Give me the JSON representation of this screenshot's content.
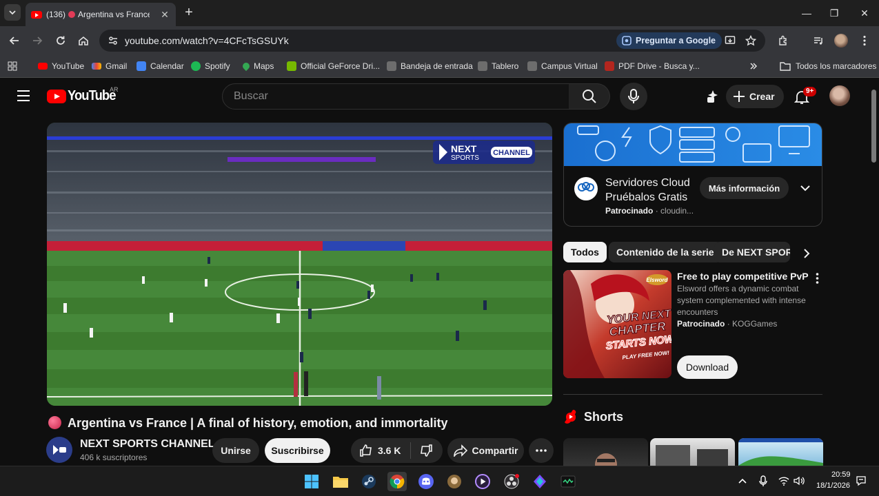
{
  "browser": {
    "tab": {
      "title": "(136)",
      "title_rest": "Argentina vs France | A"
    },
    "url": "youtube.com/watch?v=4CFcTsGSUYk",
    "ask_google": "Preguntar a Google",
    "bookmarks": [
      {
        "label": "YouTube",
        "color": "#ff0000"
      },
      {
        "label": "Gmail",
        "color": "#ea4335"
      },
      {
        "label": "Calendar",
        "color": "#4285f4"
      },
      {
        "label": "Spotify",
        "color": "#1db954"
      },
      {
        "label": "Maps",
        "color": "#34a853"
      },
      {
        "label": "Official GeForce Dri...",
        "color": "#76b900"
      },
      {
        "label": "Bandeja de entrada",
        "color": "#5f6368"
      },
      {
        "label": "Tablero",
        "color": "#5f6368"
      },
      {
        "label": "Campus Virtual",
        "color": "#5f6368"
      },
      {
        "label": "PDF Drive - Busca y...",
        "color": "#b3261e"
      }
    ],
    "all_bookmarks": "Todos los marcadores"
  },
  "yt": {
    "logo": "YouTube",
    "country": "AR",
    "search_placeholder": "Buscar",
    "create": "Crear",
    "notifications": "9+",
    "video": {
      "overlay_brand_1": "NEXT",
      "overlay_brand_2": "SPORTS",
      "overlay_brand_3": "CHANNEL",
      "title": "Argentina vs France | A final of history, emotion, and immortality",
      "channel": "NEXT SPORTS CHANNEL",
      "subscribers": "406 k suscriptores",
      "join": "Unirse",
      "subscribe": "Suscribirse",
      "likes": "3.6 K",
      "share": "Compartir"
    },
    "ad": {
      "title1": "Servidores Cloud",
      "title2": "Pruébalos Gratis",
      "sponsored": "Patrocinado",
      "advertiser": "cloudin...",
      "more_info": "Más información"
    },
    "chips": [
      "Todos",
      "Contenido de la serie",
      "De NEXT SPORTS"
    ],
    "promo": {
      "title": "Free to play competitive PvP",
      "description": "Elsword offers a dynamic combat system complemented with intense encounters",
      "sponsored": "Patrocinado",
      "advertiser": "KOGGames",
      "download": "Download",
      "thumb_text_1": "YOUR NEXT",
      "thumb_text_2": "CHAPTER",
      "thumb_text_3": "STARTS NOW!",
      "thumb_text_4": "PLAY FREE NOW!",
      "thumb_logo": "Elsword"
    },
    "shorts": "Shorts"
  },
  "taskbar": {
    "time": "20:59",
    "date": "18/1/2026"
  }
}
